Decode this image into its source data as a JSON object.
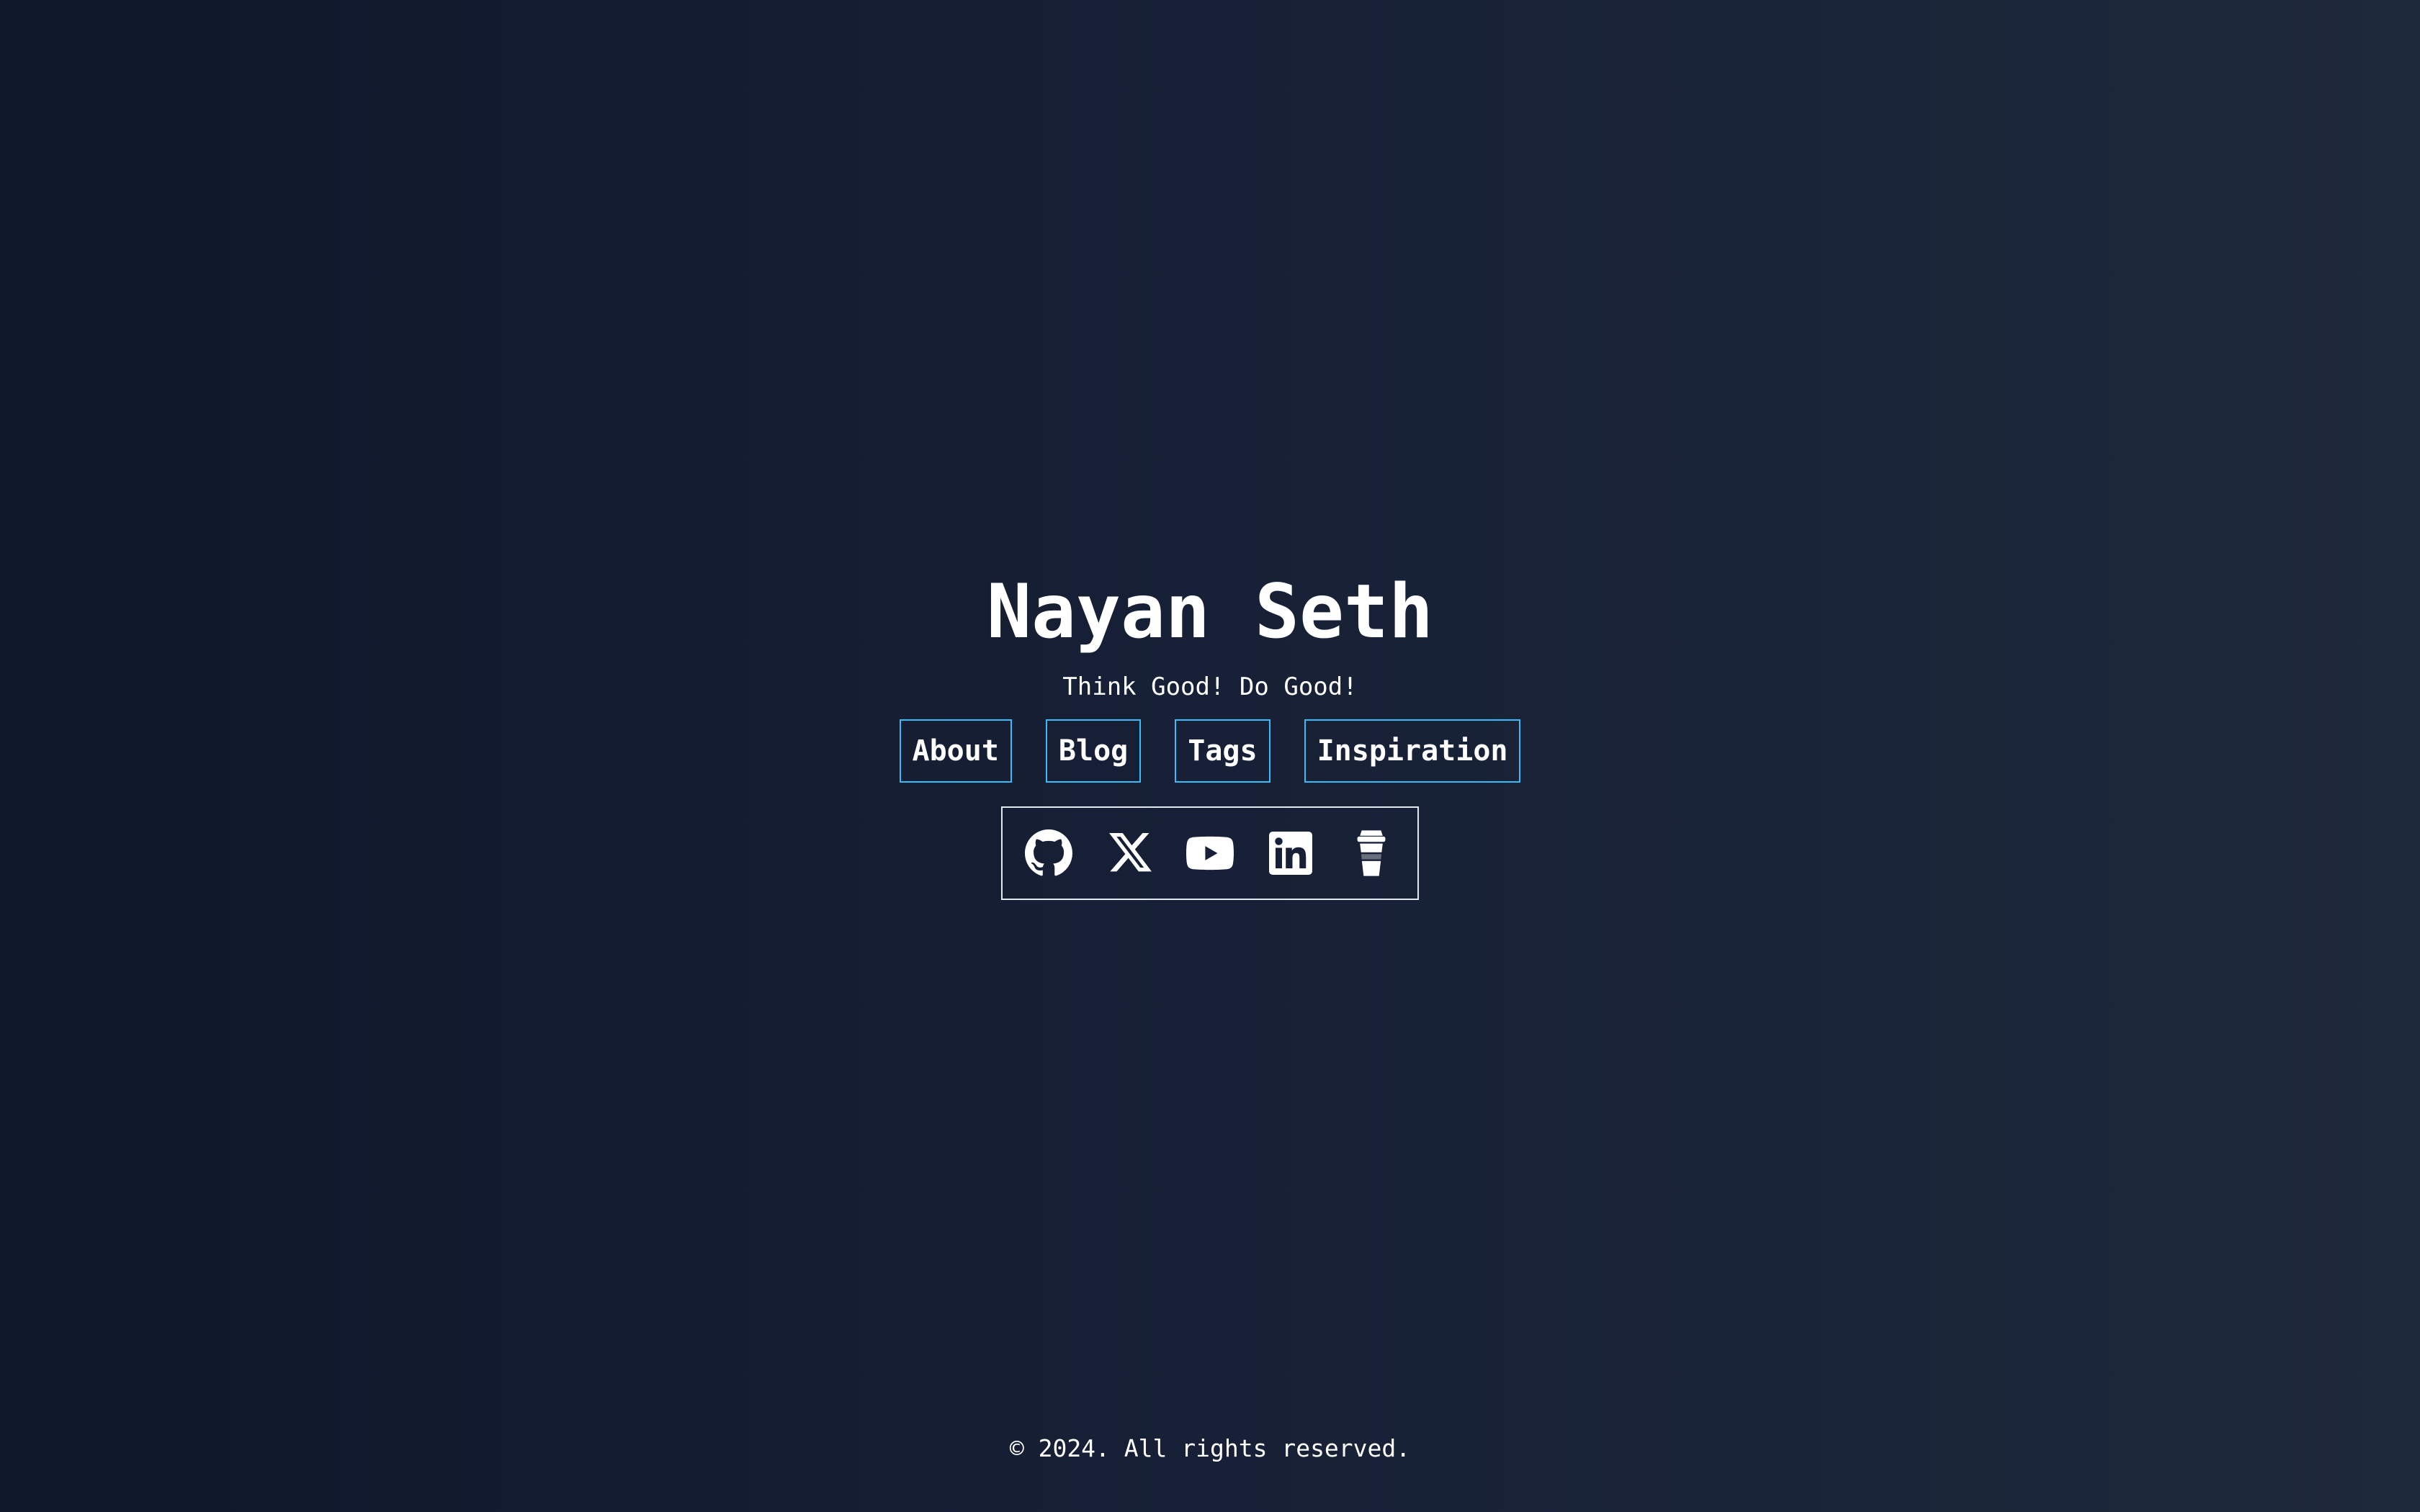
{
  "header": {
    "title": "Nayan Seth",
    "tagline": "Think Good! Do Good!"
  },
  "nav": {
    "items": [
      {
        "label": "About"
      },
      {
        "label": "Blog"
      },
      {
        "label": "Tags"
      },
      {
        "label": "Inspiration"
      }
    ]
  },
  "social": {
    "icons": [
      "github-icon",
      "x-icon",
      "youtube-icon",
      "linkedin-icon",
      "coffee-icon"
    ]
  },
  "footer": {
    "text": "© 2024. All rights reserved."
  },
  "colors": {
    "background_start": "#0f172a",
    "background_end": "#1e293b",
    "accent_border": "#38bdf8",
    "text": "#ffffff"
  }
}
